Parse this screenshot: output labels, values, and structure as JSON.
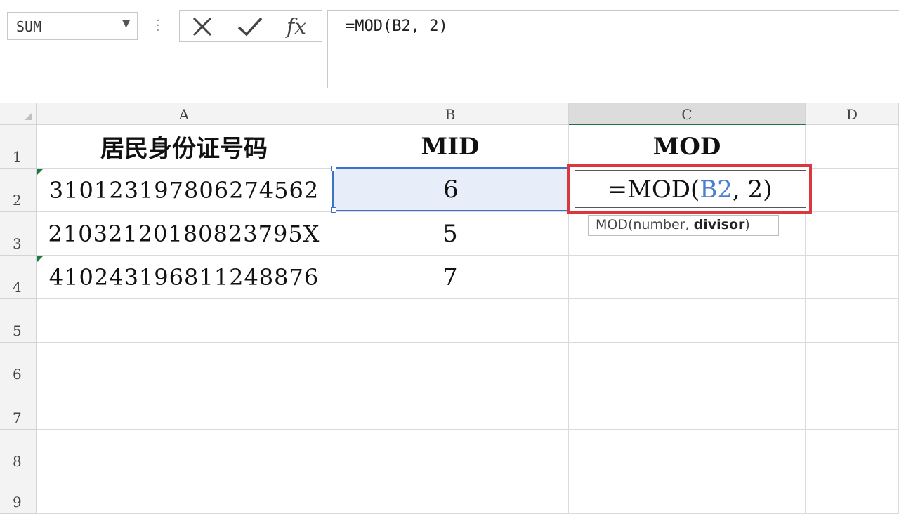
{
  "formula_bar": {
    "name_box": "SUM",
    "fx_label": "fx",
    "formula": "=MOD(B2, 2)"
  },
  "columns": [
    "A",
    "B",
    "C",
    "D"
  ],
  "rows": [
    "1",
    "2",
    "3",
    "4",
    "5",
    "6",
    "7",
    "8",
    "9"
  ],
  "sheet": {
    "A1": "居民身份证号码",
    "B1": "MID",
    "C1": "MOD",
    "A2": "310123197806274562",
    "B2": "6",
    "A3": "21032120180823795X",
    "B3": "5",
    "A4": "410243196811248876",
    "B4": "7"
  },
  "editing": {
    "cell": "C2",
    "prefix": "=MOD(",
    "ref": "B2",
    "suffix": ", 2)"
  },
  "tooltip": {
    "fn": "MOD(number, ",
    "arg": "divisor",
    "close": ")"
  },
  "colors": {
    "active_cell_border": "#d9393e",
    "reference_highlight": "#3b74c7",
    "error_indicator": "#1e7a3c"
  }
}
